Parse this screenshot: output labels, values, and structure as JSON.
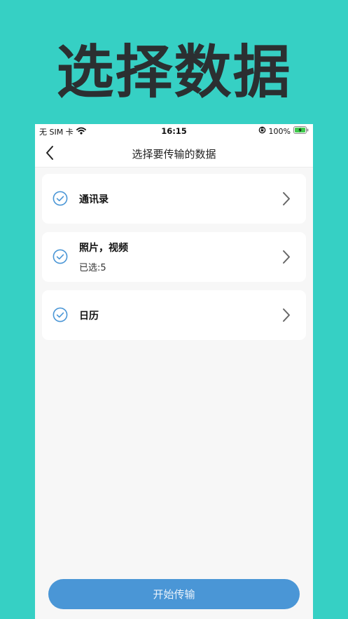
{
  "promo": {
    "title": "选择数据"
  },
  "status_bar": {
    "carrier": "无 SIM 卡",
    "time": "16:15",
    "battery": "100%"
  },
  "nav": {
    "title": "选择要传输的数据"
  },
  "items": [
    {
      "title": "通讯录",
      "subtitle": "",
      "checked": true
    },
    {
      "title": "照片，视频",
      "subtitle": "已选:5",
      "checked": true
    },
    {
      "title": "日历",
      "subtitle": "",
      "checked": true
    }
  ],
  "start_button": {
    "label": "开始传输"
  },
  "colors": {
    "background": "#36d0c4",
    "accent": "#4a96d6",
    "check": "#4a96d6"
  }
}
